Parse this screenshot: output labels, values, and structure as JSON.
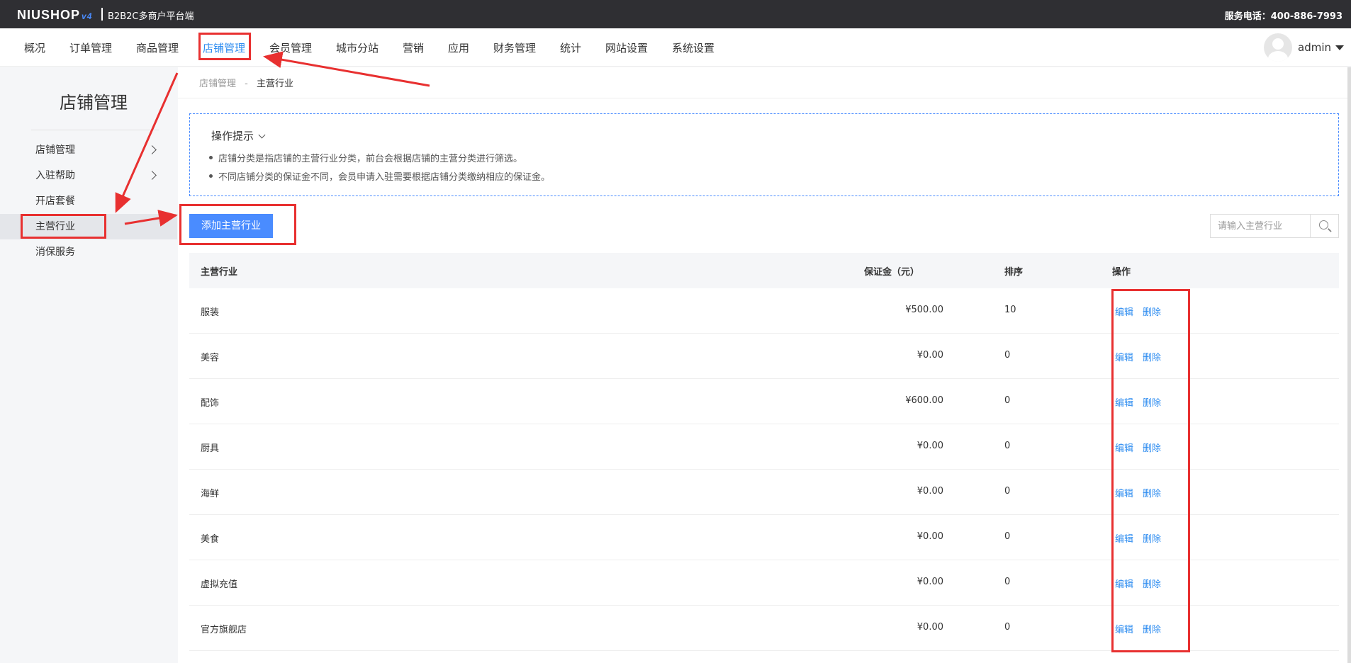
{
  "topbar": {
    "logo": "NIUSHOP",
    "logo_version": "v4",
    "platform": "B2B2C多商户平台端",
    "hotline": "服务电话：400-886-7993"
  },
  "nav": {
    "items": [
      "概况",
      "订单管理",
      "商品管理",
      "店铺管理",
      "会员管理",
      "城市分站",
      "营销",
      "应用",
      "财务管理",
      "统计",
      "网站设置",
      "系统设置"
    ],
    "active": "店铺管理",
    "username": "admin"
  },
  "sidebar": {
    "title": "店铺管理",
    "items": [
      {
        "label": "店铺管理"
      },
      {
        "label": "入驻帮助"
      },
      {
        "label": "开店套餐"
      },
      {
        "label": "主营行业"
      },
      {
        "label": "消保服务"
      }
    ]
  },
  "breadcrumb": {
    "parent": "店铺管理",
    "sep": "-",
    "current": "主营行业"
  },
  "tips": {
    "title": "操作提示",
    "lines": [
      "店铺分类是指店铺的主营行业分类，前台会根据店铺的主营分类进行筛选。",
      "不同店铺分类的保证金不同，会员申请入驻需要根据店铺分类缴纳相应的保证金。"
    ]
  },
  "toolbar": {
    "add_label": "添加主营行业",
    "search_placeholder": "请输入主营行业"
  },
  "table": {
    "headers": {
      "name": "主营行业",
      "deposit": "保证金（元）",
      "sort": "排序",
      "ops": "操作"
    },
    "rows": [
      {
        "name": "服装",
        "deposit": "¥500.00",
        "sort": "10"
      },
      {
        "name": "美容",
        "deposit": "¥0.00",
        "sort": "0"
      },
      {
        "name": "配饰",
        "deposit": "¥600.00",
        "sort": "0"
      },
      {
        "name": "厨具",
        "deposit": "¥0.00",
        "sort": "0"
      },
      {
        "name": "海鲜",
        "deposit": "¥0.00",
        "sort": "0"
      },
      {
        "name": "美食",
        "deposit": "¥0.00",
        "sort": "0"
      },
      {
        "name": "虚拟充值",
        "deposit": "¥0.00",
        "sort": "0"
      },
      {
        "name": "官方旗舰店",
        "deposit": "¥0.00",
        "sort": "0"
      }
    ],
    "edit_label": "编辑",
    "delete_label": "删除"
  },
  "colors": {
    "accent": "#4a8cff",
    "link": "#2d8cf0",
    "highlight": "#e83030"
  }
}
